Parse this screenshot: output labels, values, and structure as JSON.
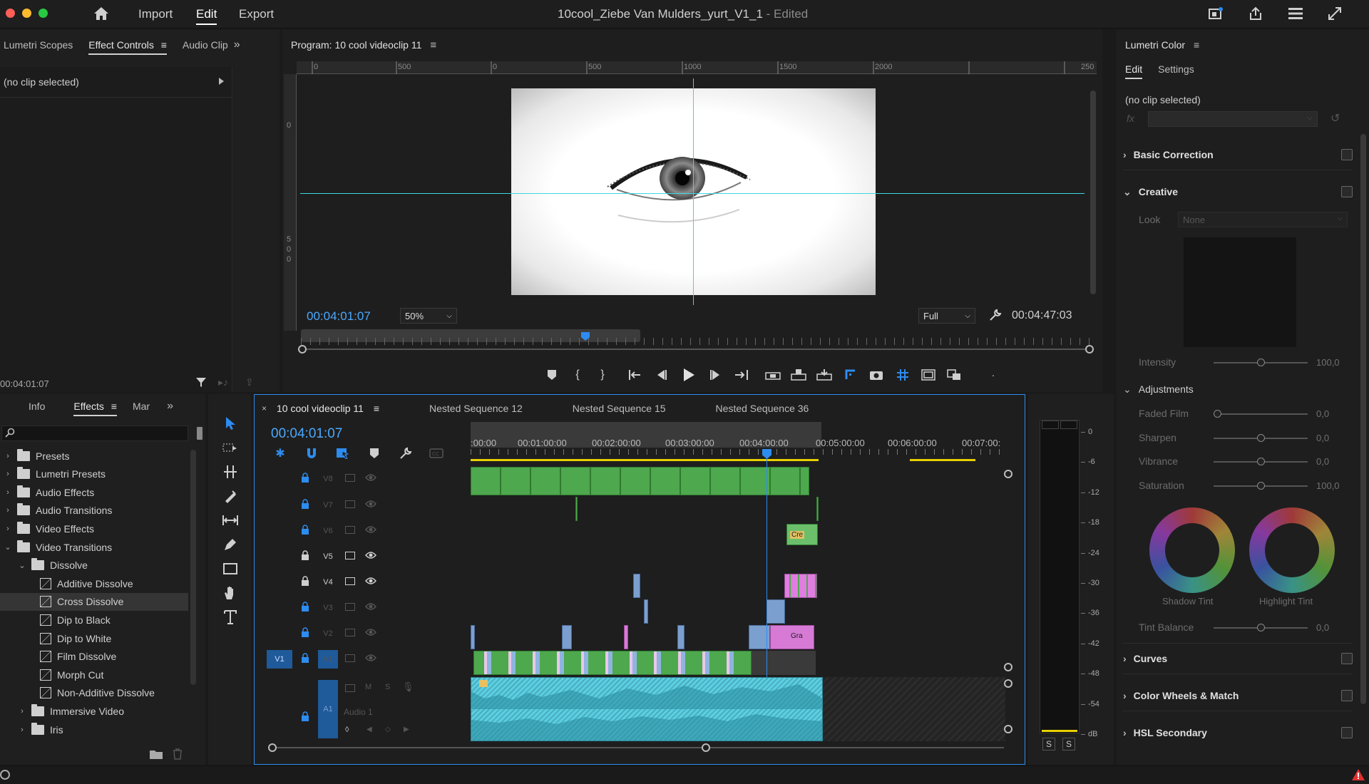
{
  "titlebar": {
    "nav": [
      "Import",
      "Edit",
      "Export"
    ],
    "active_nav": "Edit",
    "doc_title": "10cool_Ziebe Van Mulders_yurt_V1_1",
    "doc_status": " - Edited"
  },
  "left_tabs": [
    "Lumetri Scopes",
    "Effect Controls",
    "Audio Clip"
  ],
  "effect_controls": {
    "no_clip": "(no clip selected)",
    "timecode": "00:04:01:07"
  },
  "program": {
    "title": "Program: 10 cool videoclip 11",
    "ruler_ticks": [
      "0",
      "500",
      "0",
      "500",
      "1000",
      "1500",
      "2000",
      "250"
    ],
    "vruler_ticks": [
      "0",
      "5",
      "0",
      "0"
    ],
    "timecode": "00:04:01:07",
    "zoom": "50%",
    "quality": "Full",
    "duration": "00:04:47:03"
  },
  "bottom_left_tabs": [
    "Info",
    "Effects",
    "Mar"
  ],
  "effects": {
    "search_placeholder": "",
    "items": [
      {
        "label": "Presets",
        "type": "folder",
        "level": 0,
        "open": false
      },
      {
        "label": "Lumetri Presets",
        "type": "folder",
        "level": 0,
        "open": false
      },
      {
        "label": "Audio Effects",
        "type": "folder",
        "level": 0,
        "open": false
      },
      {
        "label": "Audio Transitions",
        "type": "folder",
        "level": 0,
        "open": false
      },
      {
        "label": "Video Effects",
        "type": "folder",
        "level": 0,
        "open": false
      },
      {
        "label": "Video Transitions",
        "type": "folder",
        "level": 0,
        "open": true
      },
      {
        "label": "Dissolve",
        "type": "folder",
        "level": 1,
        "open": true
      },
      {
        "label": "Additive Dissolve",
        "type": "item",
        "level": 2
      },
      {
        "label": "Cross Dissolve",
        "type": "item",
        "level": 2,
        "selected": true
      },
      {
        "label": "Dip to Black",
        "type": "item",
        "level": 2
      },
      {
        "label": "Dip to White",
        "type": "item",
        "level": 2
      },
      {
        "label": "Film Dissolve",
        "type": "item",
        "level": 2
      },
      {
        "label": "Morph Cut",
        "type": "item",
        "level": 2
      },
      {
        "label": "Non-Additive Dissolve",
        "type": "item",
        "level": 2
      },
      {
        "label": "Immersive Video",
        "type": "folder",
        "level": 1,
        "open": false
      },
      {
        "label": "Iris",
        "type": "folder",
        "level": 1,
        "open": false
      }
    ]
  },
  "timeline": {
    "tabs": [
      "10 cool videoclip 11",
      "Nested Sequence 12",
      "Nested Sequence 15",
      "Nested Sequence 36"
    ],
    "timecode": "00:04:01:07",
    "ruler": [
      ":00:00",
      "00:01:00:00",
      "00:02:00:00",
      "00:03:00:00",
      "00:04:00:00",
      "00:05:00:00",
      "00:06:00:00",
      "00:07:00:"
    ],
    "tracks": [
      "V8",
      "V7",
      "V6",
      "V5",
      "V4",
      "V3",
      "V2",
      "V1"
    ],
    "source_patch": "V1",
    "audio_track": "A1",
    "audio_name": "Audio 1",
    "audio_buttons": [
      "M",
      "S"
    ],
    "clip_labels": {
      "v6": "Cre",
      "v2": "Gra"
    }
  },
  "meter": {
    "scale": [
      "0",
      "-6",
      "-12",
      "-18",
      "-24",
      "-30",
      "-36",
      "-42",
      "-48",
      "-54",
      "dB"
    ],
    "solo": [
      "S",
      "S"
    ]
  },
  "lumetri": {
    "title": "Lumetri Color",
    "tabs": [
      "Edit",
      "Settings"
    ],
    "no_clip": "(no clip selected)",
    "basic_correction": "Basic Correction",
    "creative": "Creative",
    "look_label": "Look",
    "look_value": "None",
    "intensity_label": "Intensity",
    "intensity_value": "100,0",
    "adjustments": "Adjustments",
    "adj": [
      {
        "label": "Faded Film",
        "value": "0,0",
        "level": 0
      },
      {
        "label": "Sharpen",
        "value": "0,0",
        "level": 0.5
      },
      {
        "label": "Vibrance",
        "value": "0,0",
        "level": 0.5
      },
      {
        "label": "Saturation",
        "value": "100,0",
        "level": 0.5
      }
    ],
    "shadow_tint": "Shadow Tint",
    "highlight_tint": "Highlight Tint",
    "tint_balance_label": "Tint Balance",
    "tint_balance_value": "0,0",
    "curves": "Curves",
    "color_wheels": "Color Wheels & Match",
    "hsl": "HSL Secondary"
  },
  "colors": {
    "accent": "#2d8cf0",
    "timecode": "#4aa8ff",
    "guide": "#3fd6e0",
    "clip_green": "#4ea84e",
    "audio": "#5ccfe0"
  }
}
